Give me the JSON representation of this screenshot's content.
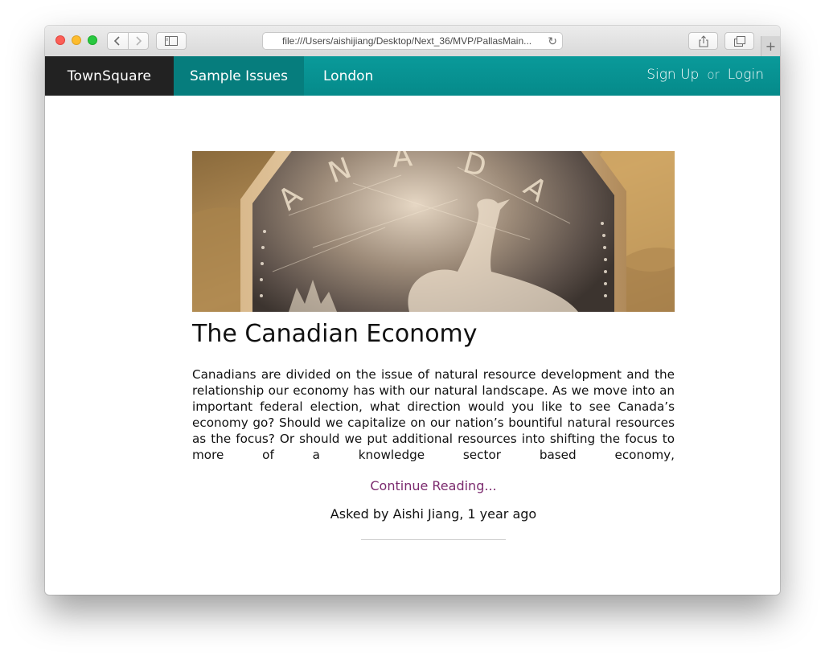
{
  "browser": {
    "address": "file:///Users/aishijiang/Desktop/Next_36/MVP/PallasMain...",
    "new_tab_label": "+"
  },
  "site_nav": {
    "brand": "TownSquare",
    "items": [
      {
        "label": "Sample Issues",
        "active": true
      },
      {
        "label": "London",
        "active": false
      }
    ],
    "sign_up": "Sign Up",
    "or": "or",
    "login": "Login"
  },
  "article": {
    "image_alt": "CANADA",
    "title": "The Canadian Economy",
    "body": "Canadians are divided on the issue of natural resource development and the relationship our economy has with our natural landscape. As we move into an important federal election, what direction would you like to see Canada’s economy go? Should we capitalize on our nation’s bountiful natural resources as the focus? Or should we put additional resources into shifting the focus to more of a knowledge sector based economy,",
    "continue_label": "Continue Reading...",
    "asked_by": "Asked by Aishi Jiang, 1 year ago"
  },
  "colors": {
    "nav_teal": "#058a8a",
    "nav_active": "#067d7d",
    "brand_bg": "#222222",
    "link_purple": "#7b2a6e"
  }
}
